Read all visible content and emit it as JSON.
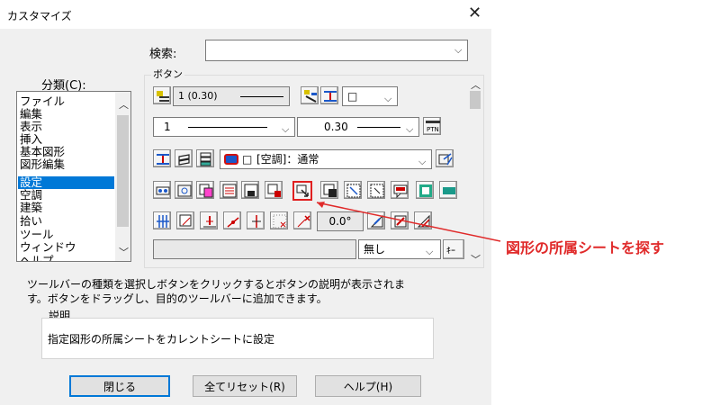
{
  "window": {
    "title": "カスタマイズ"
  },
  "search": {
    "label": "検索:",
    "value": ""
  },
  "category": {
    "label": "分類(C):",
    "items": [
      "ファイル",
      "編集",
      "表示",
      "挿入",
      "基本図形",
      "図形編集",
      "設定",
      "空調",
      "建築",
      "拾い",
      "ツール",
      "ウィンドウ",
      "ヘルプ"
    ],
    "selected": "設定"
  },
  "buttons_group": {
    "label": "ボタン",
    "row1": {
      "width_value": "1 (0.30)"
    },
    "row2": {
      "line_type": "1",
      "line_width": "0.30",
      "ptn_label": "PTN"
    },
    "row3": {
      "layer_value": "[空調]：通常"
    },
    "row5": {
      "angle_value": "0.0°"
    },
    "row6": {
      "select_value": "無し",
      "key_label": "ｷｰ"
    }
  },
  "description_text": {
    "line1": "ツールバーの種類を選択しボタンをクリックするとボタンの説明が表示されま",
    "line2": "す。ボタンをドラッグし、目的のツールバーに追加できます。"
  },
  "explanation": {
    "label": "説明",
    "text": "指定図形の所属シートをカレントシートに設定"
  },
  "footer": {
    "close_label": "閉じる",
    "reset_label": "全てリセット(R)",
    "help_label": "ヘルプ(H)"
  },
  "annotation": {
    "text": "図形の所属シートを探す",
    "color": "#e02a2a"
  },
  "colors": {
    "accent": "#0078d7",
    "highlight": "#e02020"
  }
}
